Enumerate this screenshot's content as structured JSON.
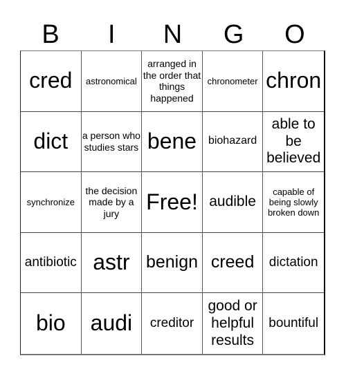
{
  "header": {
    "letters": [
      "B",
      "I",
      "N",
      "G",
      "O"
    ]
  },
  "grid": {
    "rows": [
      [
        "cred",
        "astronomical",
        "arranged in the order that things happened",
        "chronometer",
        "chron"
      ],
      [
        "dict",
        "a person who studies stars",
        "bene",
        "biohazard",
        "able to be believed"
      ],
      [
        "synchronize",
        "the decision made by a jury",
        "Free!",
        "audible",
        "capable of being slowly broken down"
      ],
      [
        "antibiotic",
        "astr",
        "benign",
        "creed",
        "dictation"
      ],
      [
        "bio",
        "audi",
        "creditor",
        "good or helpful results",
        "bountiful"
      ]
    ],
    "free_space": "Free!"
  }
}
